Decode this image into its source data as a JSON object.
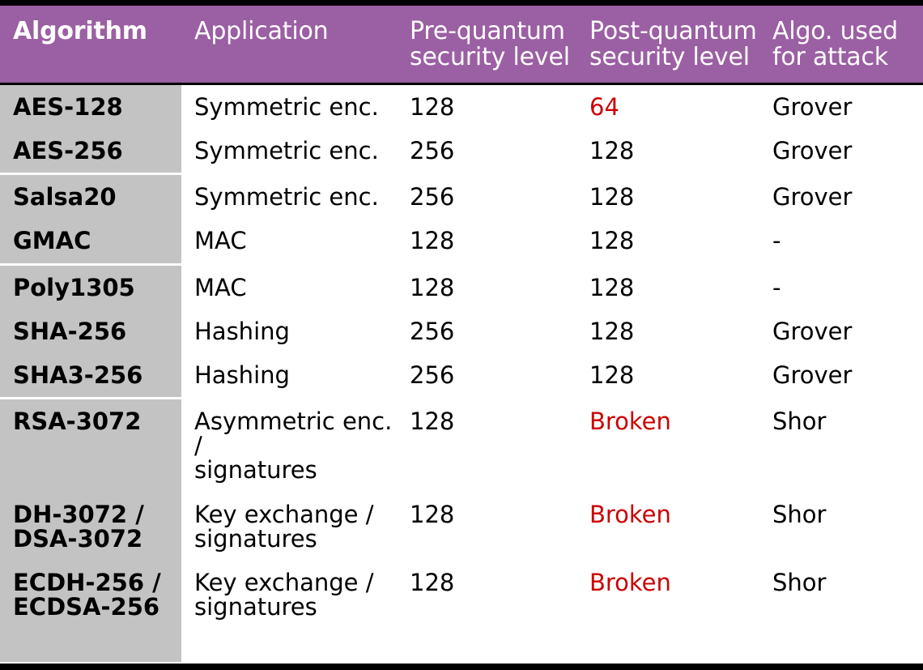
{
  "table": {
    "columns": [
      {
        "key": "algorithm",
        "label": "Algorithm"
      },
      {
        "key": "application",
        "label": "Application"
      },
      {
        "key": "pre_quantum",
        "label": "Pre-quantum\nsecurity level"
      },
      {
        "key": "post_quantum",
        "label": "Post-quantum\nsecurity level"
      },
      {
        "key": "attack_algo",
        "label": "Algo. used\nfor attack"
      }
    ],
    "colors": {
      "header_background": "#9B5FA3",
      "header_text": "#FFFFFF",
      "first_column_background": "#C3C3C3",
      "body_background": "#FFFFFF",
      "body_text": "#000000",
      "warning_text": "#CC0000",
      "frame": "#000000"
    },
    "rows": [
      {
        "algorithm": "AES-128",
        "application": "Symmetric enc.",
        "pre_quantum": "128",
        "post_quantum": "64",
        "post_quantum_warning": true,
        "attack_algo": "Grover",
        "divider_after": false
      },
      {
        "algorithm": "AES-256",
        "application": "Symmetric enc.",
        "pre_quantum": "256",
        "post_quantum": "128",
        "post_quantum_warning": false,
        "attack_algo": "Grover",
        "divider_after": true
      },
      {
        "algorithm": "Salsa20",
        "application": "Symmetric enc.",
        "pre_quantum": "256",
        "post_quantum": "128",
        "post_quantum_warning": false,
        "attack_algo": "Grover",
        "divider_after": false
      },
      {
        "algorithm": "GMAC",
        "application": "MAC",
        "pre_quantum": "128",
        "post_quantum": "128",
        "post_quantum_warning": false,
        "attack_algo": "-",
        "divider_after": true
      },
      {
        "algorithm": "Poly1305",
        "application": "MAC",
        "pre_quantum": "128",
        "post_quantum": "128",
        "post_quantum_warning": false,
        "attack_algo": "-",
        "divider_after": false
      },
      {
        "algorithm": "SHA-256",
        "application": "Hashing",
        "pre_quantum": "256",
        "post_quantum": "128",
        "post_quantum_warning": false,
        "attack_algo": "Grover",
        "divider_after": false
      },
      {
        "algorithm": "SHA3-256",
        "application": "Hashing",
        "pre_quantum": "256",
        "post_quantum": "128",
        "post_quantum_warning": false,
        "attack_algo": "Grover",
        "divider_after": true
      },
      {
        "algorithm": "RSA-3072",
        "application": "Asymmetric enc. /\nsignatures",
        "pre_quantum": "128",
        "post_quantum": "Broken",
        "post_quantum_warning": true,
        "attack_algo": "Shor",
        "divider_after": false
      },
      {
        "algorithm": "DH-3072 /\nDSA-3072",
        "application": "Key exchange /\nsignatures",
        "pre_quantum": "128",
        "post_quantum": "Broken",
        "post_quantum_warning": true,
        "attack_algo": "Shor",
        "divider_after": false
      },
      {
        "algorithm": "ECDH-256 /\nECDSA-256",
        "application": "Key exchange /\nsignatures",
        "pre_quantum": "128",
        "post_quantum": "Broken",
        "post_quantum_warning": true,
        "attack_algo": "Shor",
        "divider_after": false
      }
    ]
  }
}
